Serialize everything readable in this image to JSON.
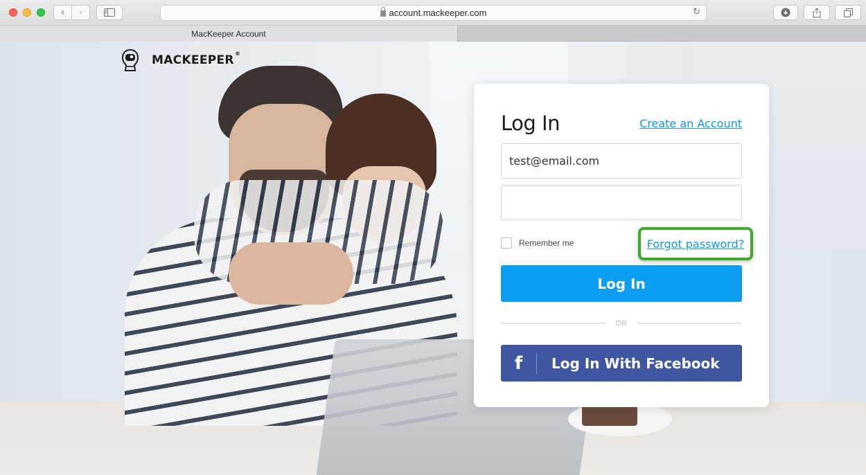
{
  "browser": {
    "url": "account.mackeeper.com",
    "tab_title": "MacKeeper Account",
    "back_symbol": "‹",
    "forward_symbol": "›",
    "reload_symbol": "↻",
    "download_symbol": "⬇",
    "share_symbol": "⇧",
    "tabs_symbol": "❐"
  },
  "logo": {
    "text": "MACKEEPER",
    "registered": "®"
  },
  "login": {
    "title": "Log In",
    "create_account_label": "Create an Account",
    "email_value": "test@email.com",
    "password_value": "",
    "remember_label": "Remember me",
    "forgot_label": "Forgot password?",
    "login_button_label": "Log In",
    "or_label": "OR",
    "facebook_icon": "f",
    "facebook_button_label": "Log In With Facebook"
  },
  "colors": {
    "accent_blue": "#0a9df2",
    "facebook_blue": "#3e57a0",
    "highlight_green": "#3fab2a",
    "link_blue": "#0d97e6"
  }
}
